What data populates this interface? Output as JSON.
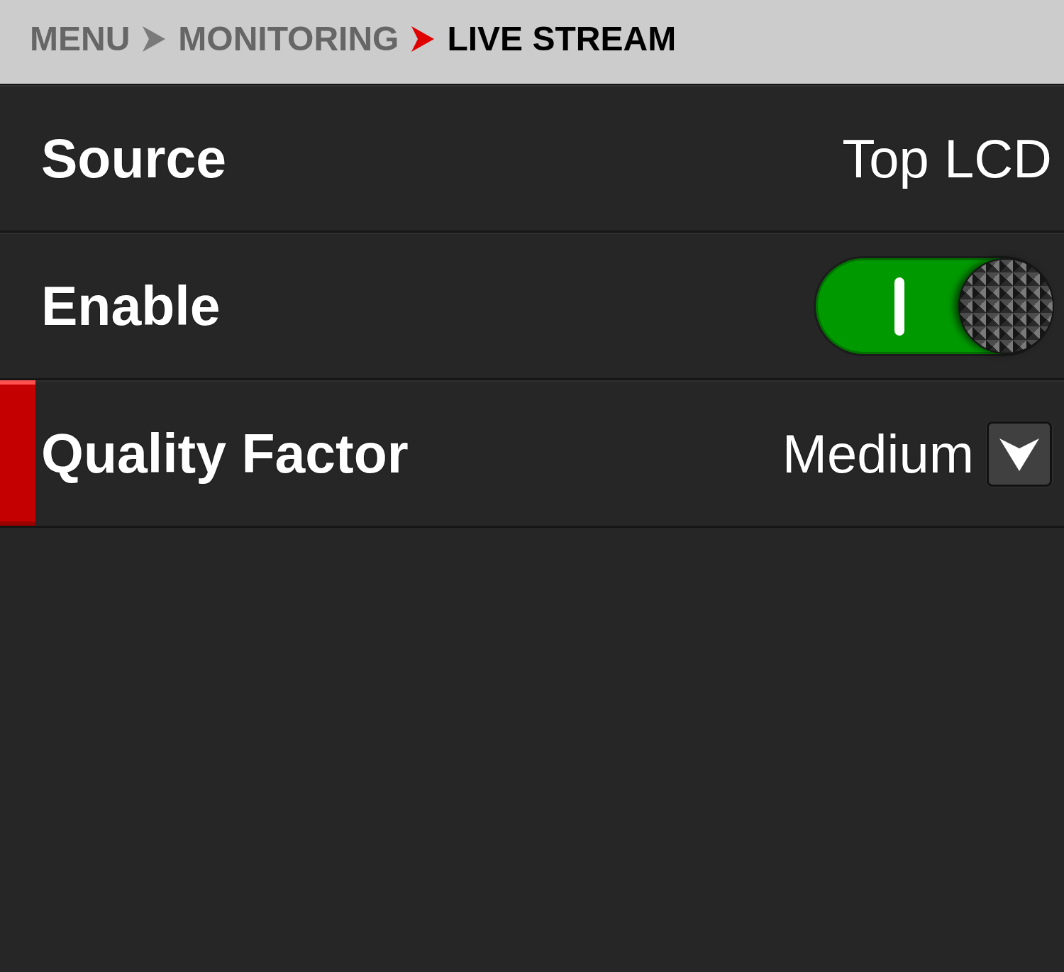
{
  "breadcrumb": [
    {
      "label": "MENU",
      "current": false
    },
    {
      "label": "MONITORING",
      "current": false
    },
    {
      "label": "LIVE STREAM",
      "current": true
    }
  ],
  "settings": [
    {
      "kind": "value",
      "label": "Source",
      "value": "Top LCD",
      "selected": false
    },
    {
      "kind": "toggle",
      "label": "Enable",
      "on": true,
      "selected": false
    },
    {
      "kind": "dropdown",
      "label": "Quality Factor",
      "value": "Medium",
      "selected": true
    }
  ]
}
